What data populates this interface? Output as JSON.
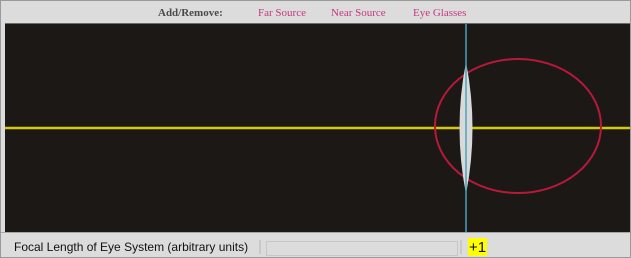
{
  "toolbar": {
    "add_remove_label": "Add/Remove:",
    "far_source_label": "Far Source",
    "near_source_label": "Near Source",
    "eye_glasses_label": "Eye Glasses"
  },
  "controls": {
    "focal_length_label": "Focal Length of Eye System (arbitrary units)",
    "focal_length_value": "+1"
  },
  "colors": {
    "canvas_background": "#1c1815",
    "optical_axis": "#d8c800",
    "lens": "#d9d9d9",
    "eye": "#b8193b",
    "retina_line": "#4aa3bd",
    "link": "#c8377d",
    "value_highlight": "#ffff00"
  }
}
